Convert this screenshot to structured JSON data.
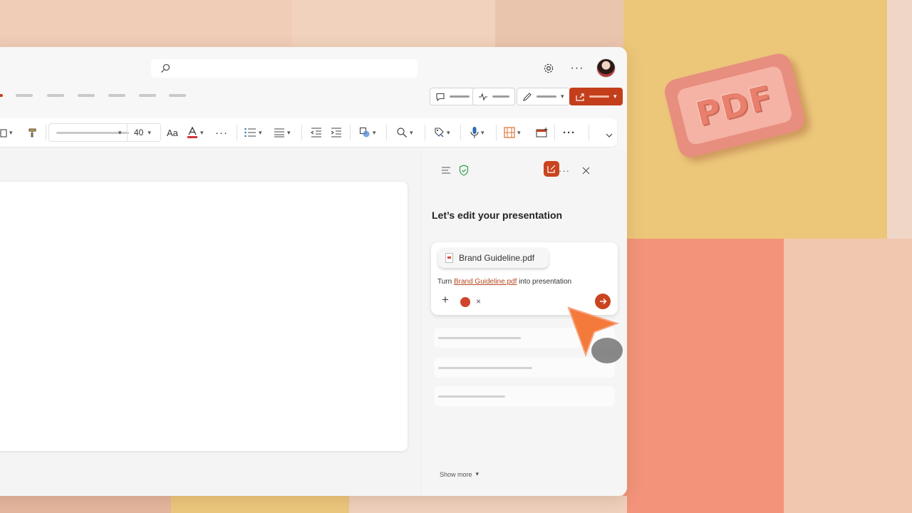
{
  "background": {
    "badge_text": "PDF"
  },
  "app": {
    "search": {
      "placeholder": ""
    },
    "toolbar": {
      "font_size": "40",
      "change_case_label": "Aa"
    }
  },
  "copilot": {
    "title": "Let’s edit your presentation",
    "attachment": {
      "file_name": "Brand Guideline.pdf"
    },
    "prompt": {
      "prefix": "Turn ",
      "link": "Brand Guideline.pdf",
      "suffix": " into presentation"
    },
    "show_more_label": "Show more"
  },
  "colors": {
    "accent": "#c43e1c",
    "pane_bg": "#f5f5f5",
    "window_bg": "#f7f7f7"
  },
  "icons": [
    "search-icon",
    "settings-icon",
    "more-icon",
    "comment-icon",
    "activity-icon",
    "pen-icon",
    "share-icon",
    "format-painter-icon",
    "font-color-icon",
    "bullets-icon",
    "align-icon",
    "indent-icon",
    "outdent-icon",
    "shapes-icon",
    "find-icon",
    "sensitivity-icon",
    "dictate-icon",
    "designer-icon",
    "add-in-icon",
    "expand-icon",
    "menu-icon",
    "shield-icon",
    "new-chat-icon",
    "close-icon",
    "pdf-file-icon",
    "add-icon",
    "send-icon"
  ]
}
